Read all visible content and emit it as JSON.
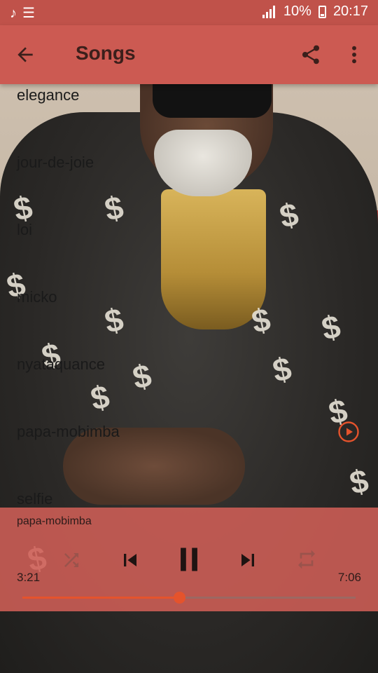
{
  "status_bar": {
    "left_icons": [
      "music-note-icon",
      "list-icon"
    ],
    "battery": "10%",
    "time": "20:17"
  },
  "app_bar": {
    "title": "Songs"
  },
  "songs": [
    {
      "title": "elegance",
      "playing": false
    },
    {
      "title": "jour-de-joie",
      "playing": false
    },
    {
      "title": "loi",
      "playing": false
    },
    {
      "title": "micko",
      "playing": false
    },
    {
      "title": "nyataquance",
      "playing": false
    },
    {
      "title": "papa-mobimba",
      "playing": true
    },
    {
      "title": "selfie",
      "playing": false
    }
  ],
  "player": {
    "now_playing": "papa-mobimba",
    "current_time": "3:21",
    "total_time": "7:06",
    "progress": 0.47,
    "state": "playing"
  },
  "colors": {
    "status_bar": "#c0524a",
    "app_bar": "#cc5a52",
    "accent": "#e5532c",
    "player_bg": "#cf5f57"
  }
}
